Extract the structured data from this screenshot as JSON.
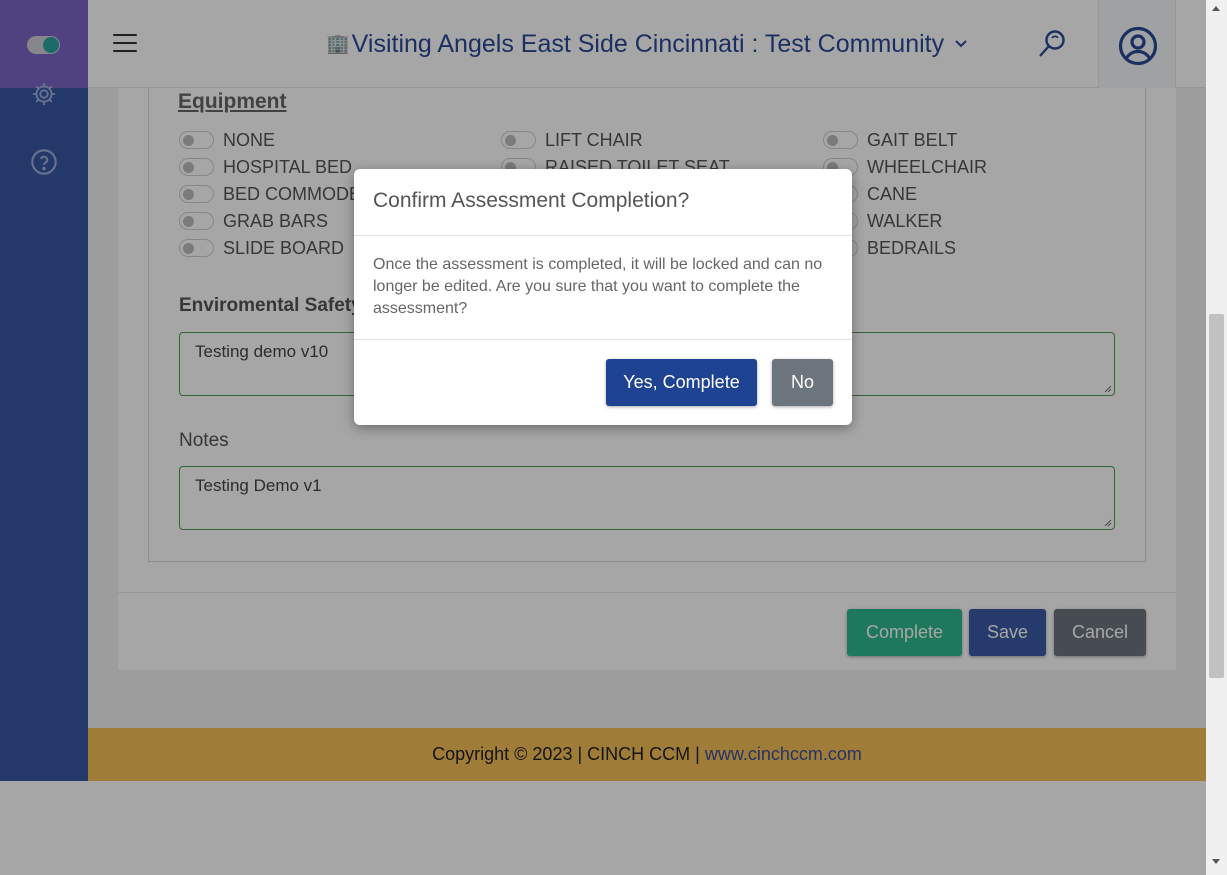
{
  "header": {
    "community_name": "Visiting Angels East Side Cincinnati : Test Community",
    "building_glyph": "🏢"
  },
  "form": {
    "equipment_title": "Equipment",
    "equipment_items": [
      "NONE",
      "LIFT CHAIR",
      "GAIT BELT",
      "HOSPITAL BED",
      "RAISED TOILET SEAT",
      "WHEELCHAIR",
      "BED COMMODE",
      "CANE",
      "GRAB BARS",
      "WALKER",
      "SLIDE BOARD",
      "BEDRAILS"
    ],
    "environmental_safety_label": "Enviromental Safety",
    "environmental_safety_value": "Testing demo v10",
    "notes_label": "Notes",
    "notes_value": "Testing Demo v1"
  },
  "buttons": {
    "complete": "Complete",
    "save": "Save",
    "cancel": "Cancel"
  },
  "footer": {
    "copyright": "Copyright © 2023 | CINCH CCM |",
    "link": "www.cinchccm.com"
  },
  "modal": {
    "title": "Confirm Assessment Completion?",
    "body": "Once the assessment is completed, it will be locked and can no longer be edited. Are you sure that you want to complete the assessment?",
    "confirm_label": "Yes, Complete",
    "deny_label": "No"
  },
  "icons": {
    "sidebar": [
      "gear-icon",
      "help-icon"
    ],
    "header": [
      "menu-icon",
      "building-icon",
      "chevron-down-icon",
      "search-icon",
      "user-circle-icon"
    ]
  },
  "colors": {
    "sidebar": "#3a57a3",
    "brand": "#7c64c6",
    "primary": "#2a4a97",
    "complete_button": "#2fb98e",
    "save_button": "#3b5ba6",
    "cancel_button": "#6c757d",
    "footer": "#f5bf55",
    "input_border": "#4c9c4c"
  }
}
